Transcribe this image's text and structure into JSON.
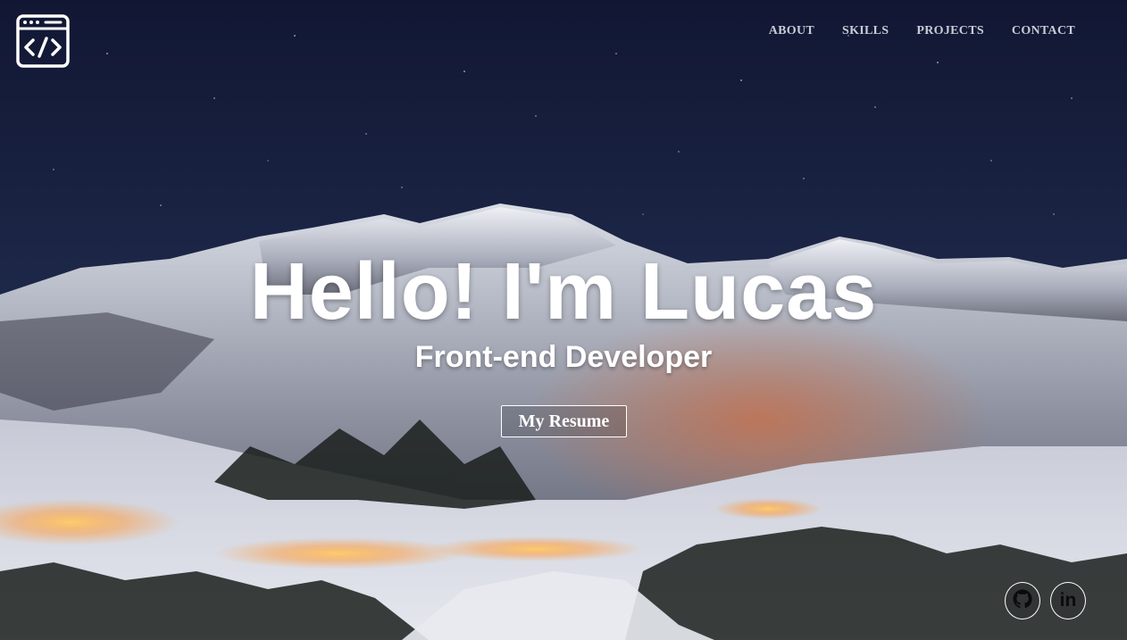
{
  "nav": {
    "items": [
      {
        "label": "ABOUT"
      },
      {
        "label": "SKILLS"
      },
      {
        "label": "PROJECTS"
      },
      {
        "label": "CONTACT"
      }
    ]
  },
  "logo": {
    "icon": "code-window-icon"
  },
  "hero": {
    "headline": "Hello! I'm Lucas",
    "subtitle": "Front-end Developer",
    "resume_button": "My Resume",
    "background": "snowy-mountain-night-photo"
  },
  "social": {
    "github": {
      "icon": "github-icon"
    },
    "linkedin": {
      "icon": "linkedin-icon",
      "glyph": "in"
    }
  },
  "colors": {
    "sky": "#141c38",
    "text": "#ffffff",
    "nav_text": "#c9ccd6"
  }
}
